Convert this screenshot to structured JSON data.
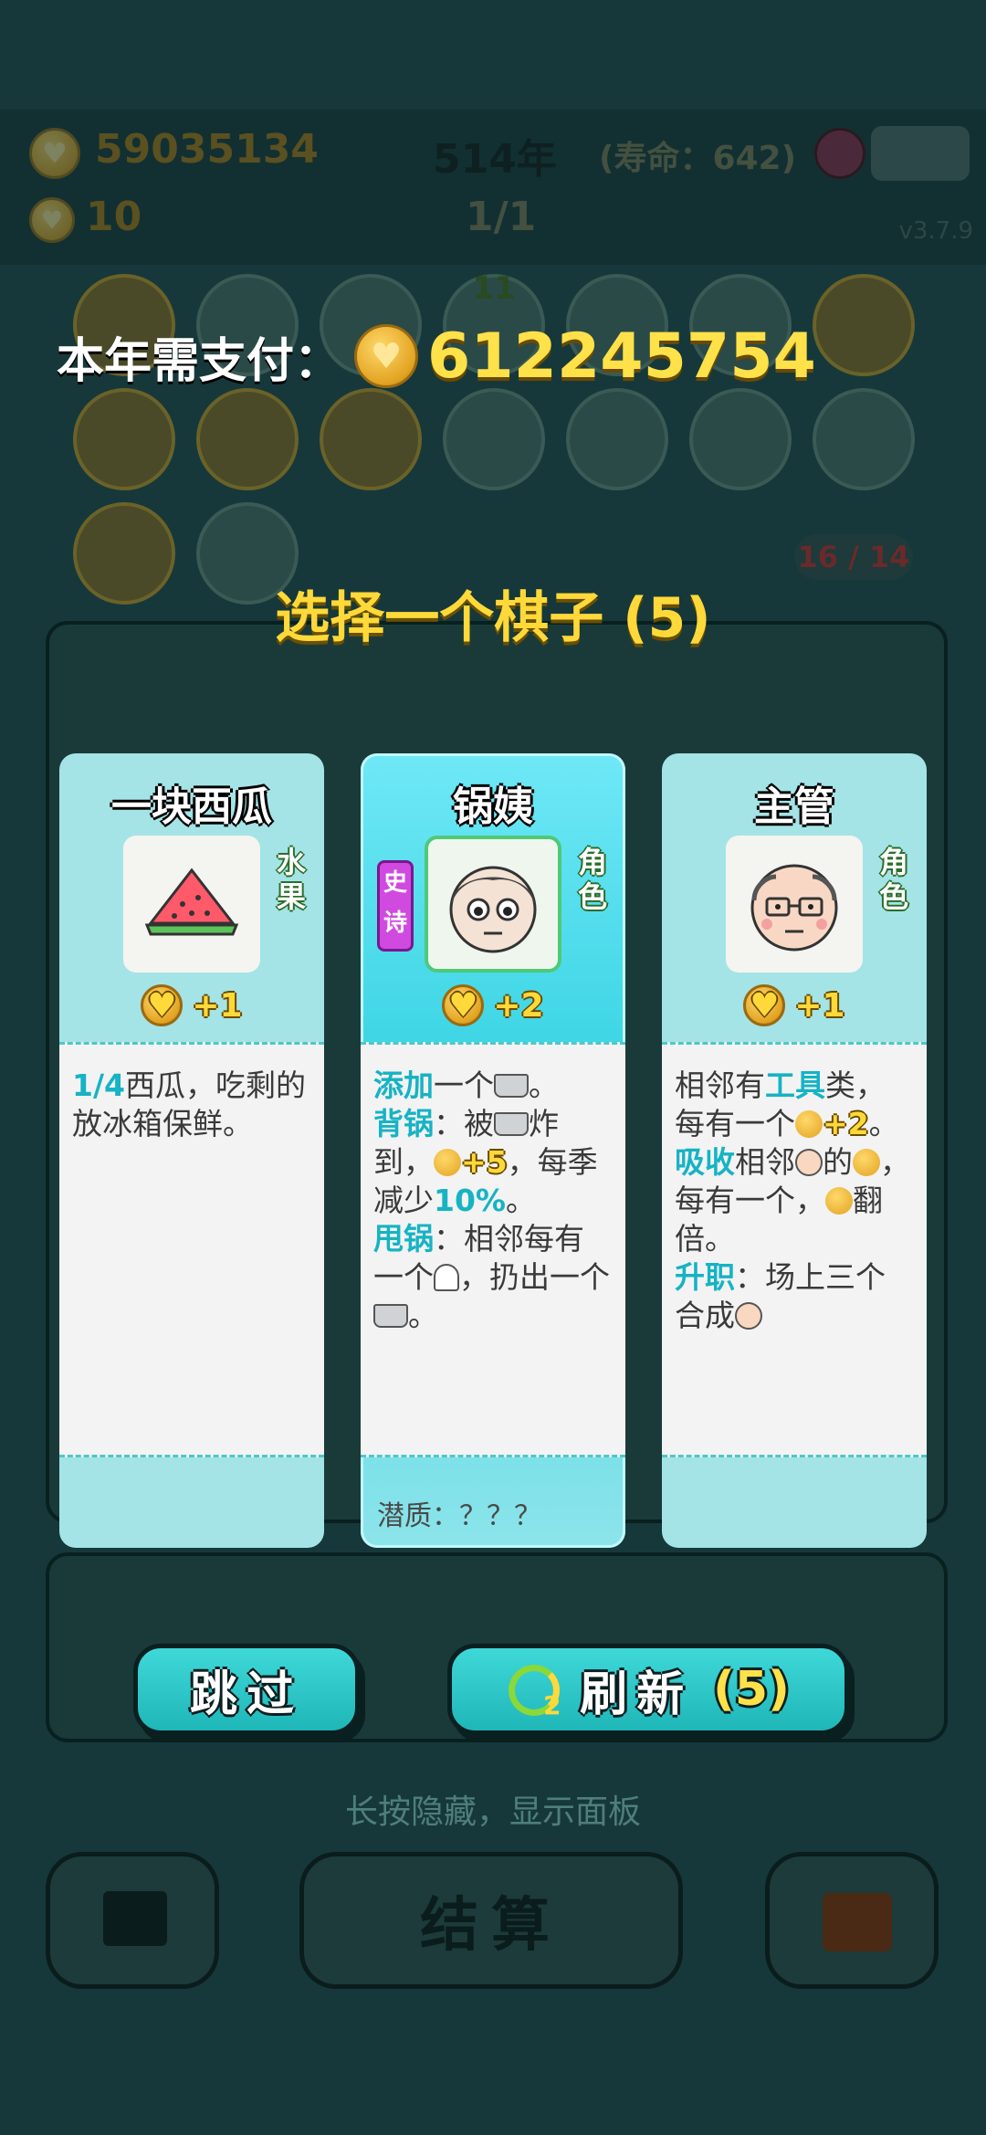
{
  "status": {
    "gold": "59035134",
    "year": "514年",
    "lifespan": "(寿命：642)",
    "tickets": "10",
    "round": "1/1",
    "version": "v3.7.9",
    "slot_badge": "11"
  },
  "board": {
    "counter": "16 / 14"
  },
  "overlay": {
    "pay_label": "本年需支付：",
    "pay_amount": "612245754",
    "choose_title": "选择一个棋子 (5)"
  },
  "cards": [
    {
      "name": "一块西瓜",
      "category": "水果",
      "icon": "watermelon-icon",
      "rarity": "",
      "gain": "+1",
      "desc_html": "<b>1/4</b>西瓜，吃剩的放冰箱保鲜。",
      "quality": ""
    },
    {
      "name": "锅姨",
      "category": "角色",
      "icon": "pot-auntie-face-icon",
      "rarity": "史诗",
      "gain": "+2",
      "desc_html": "<b>添加</b>一个<span class='pot'></span>。<br><b>背锅</b>：被<span class='pot'></span>炸到，<span class='mini'></span><span class='y'>+5</span>，每季减少<b>10%</b>。<br><b>甩锅</b>：相邻每有一个<span class='ghost'></span>，扔出一个<span class='pot'></span>。",
      "quality": "潜质：？？？"
    },
    {
      "name": "主管",
      "category": "角色",
      "icon": "manager-face-icon",
      "rarity": "",
      "gain": "+1",
      "desc_html": "相邻有<b>工具</b>类，每有一个<span class='mini'></span><span class='y'>+2</span>。<br><b>吸收</b>相邻<span class='face'></span>的<span class='mini'></span>，每有一个，<span class='mini'></span>翻倍。<br><b>升职</b>：场上三个合成<span class='face'></span>",
      "quality": ""
    }
  ],
  "buttons": {
    "skip": "跳过",
    "refresh": "刷新",
    "refresh_count": "(5)",
    "refresh_badge": "2"
  },
  "footer": {
    "hint": "长按隐藏，显示面板",
    "settle": "结算"
  },
  "colors": {
    "accent_teal": "#1fb6b8",
    "gold_text": "#ffd93a",
    "epic_purple": "#d04ae0"
  }
}
